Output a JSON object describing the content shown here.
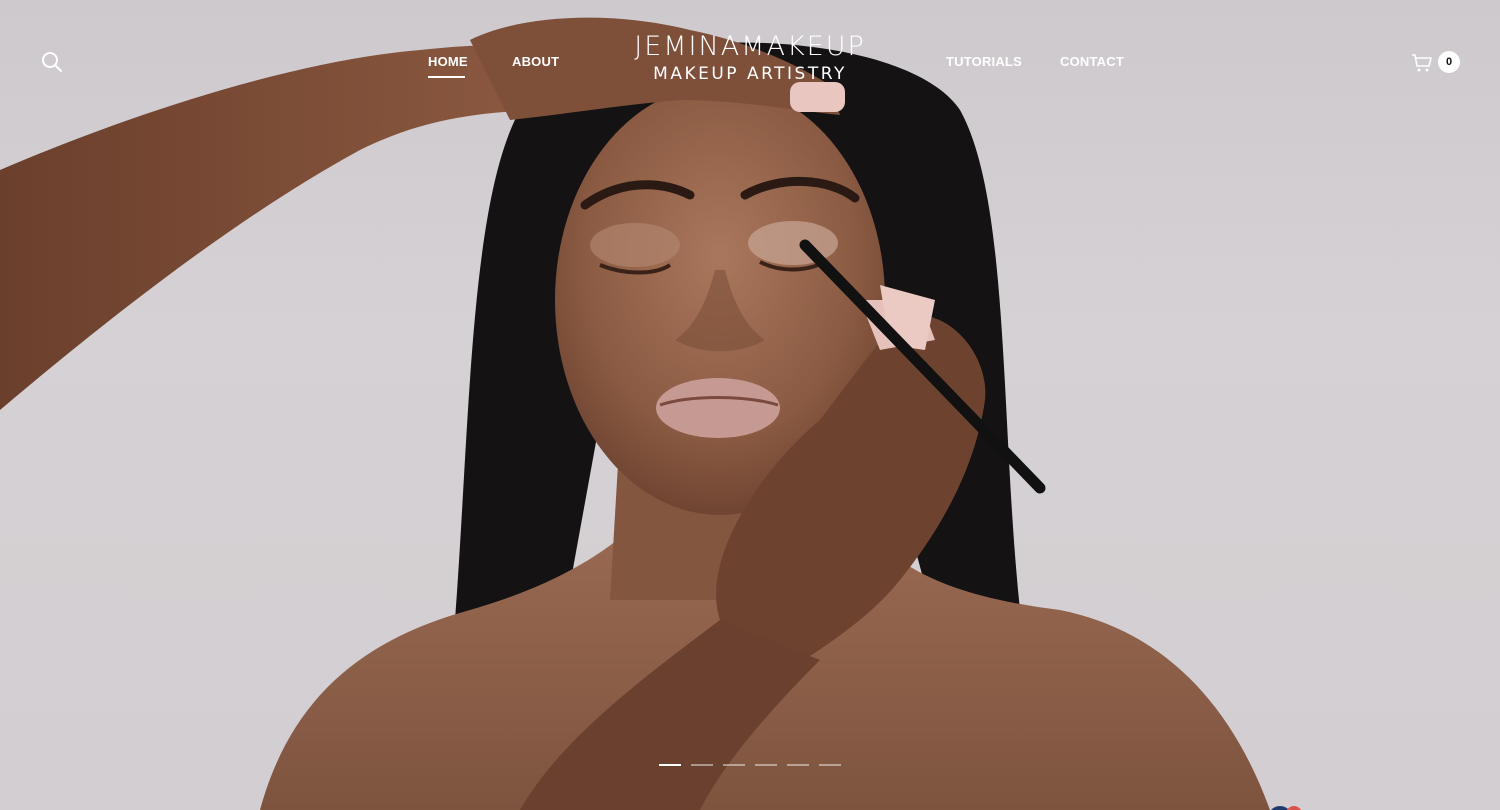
{
  "header": {
    "logo_main": "JEMINAMAKEUP",
    "logo_sub": "MAKEUP ARTISTRY",
    "nav_left": [
      {
        "label": "HOME",
        "active": true
      },
      {
        "label": "ABOUT",
        "active": false
      }
    ],
    "nav_right": [
      {
        "label": "TUTORIALS",
        "active": false
      },
      {
        "label": "CONTACT",
        "active": false
      }
    ],
    "search_icon": "search-icon",
    "cart_icon": "cart-icon",
    "cart_count": "0"
  },
  "slider": {
    "slide_count": 6,
    "active_index": 0
  },
  "colors": {
    "nav_text": "#ffffff",
    "background": "#d2ced1"
  }
}
